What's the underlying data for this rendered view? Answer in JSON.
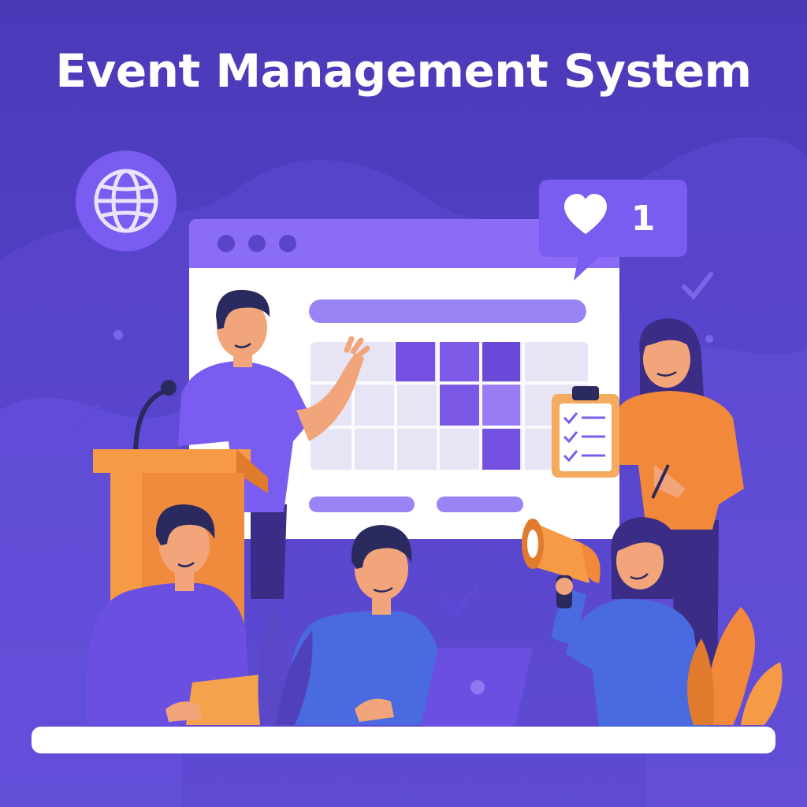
{
  "title": "Event Management System",
  "notification": {
    "count": "1"
  },
  "icons": [
    "globe-icon",
    "heart-icon",
    "microphone-icon",
    "megaphone-icon",
    "clipboard-icon",
    "checkmark-icon",
    "laptop-icon"
  ],
  "colors": {
    "background": "#4a3ab8",
    "accent_purple": "#7b5cf0",
    "orange": "#f2883a",
    "white": "#ffffff"
  }
}
